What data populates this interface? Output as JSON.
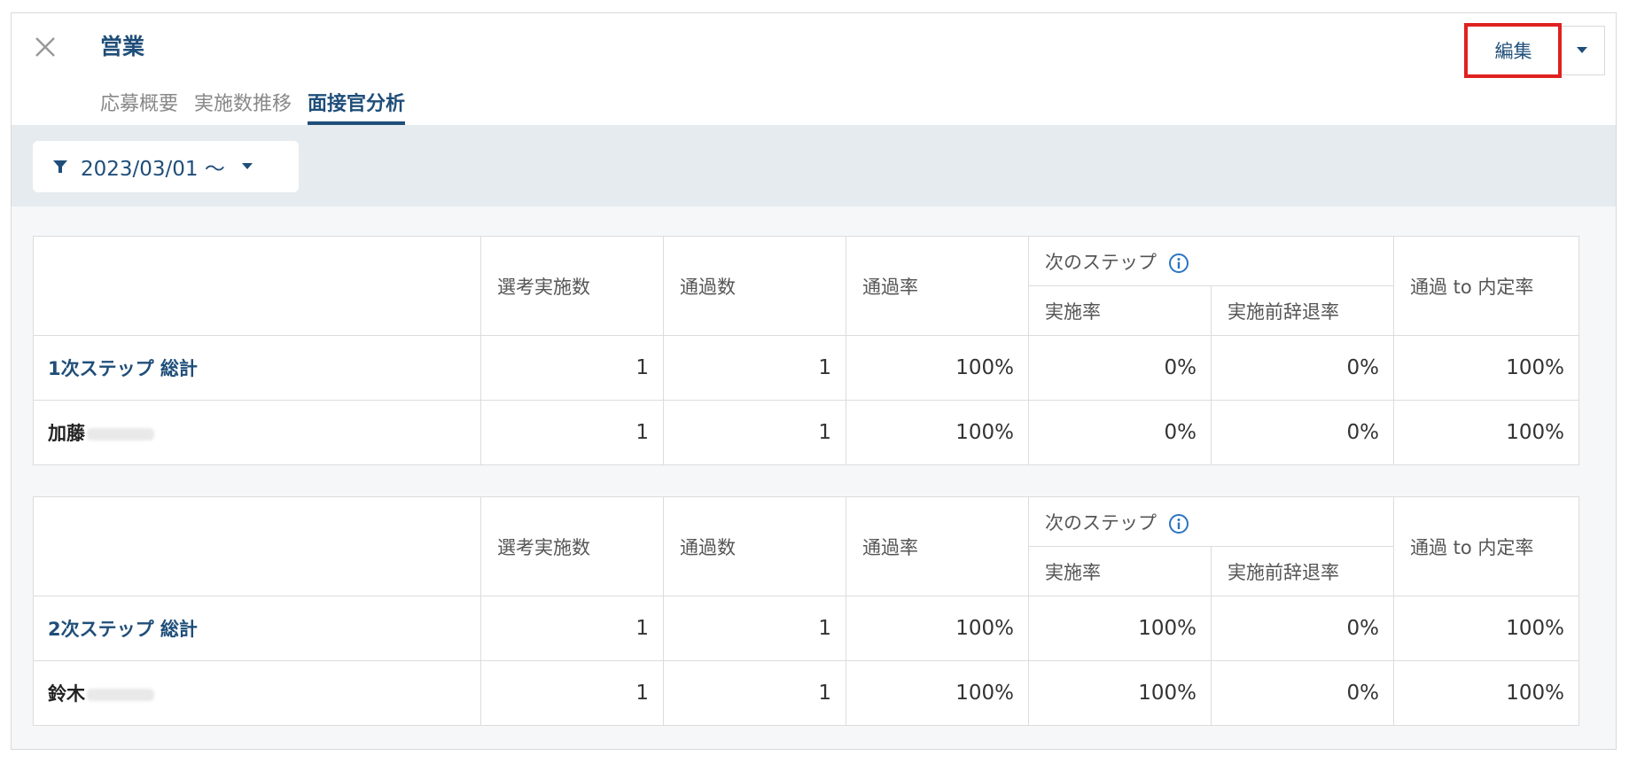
{
  "header": {
    "title": "営業",
    "tabs": [
      {
        "label": "応募概要",
        "active": false
      },
      {
        "label": "実施数推移",
        "active": false
      },
      {
        "label": "面接官分析",
        "active": true
      }
    ],
    "edit_label": "編集"
  },
  "filter": {
    "label": "2023/03/01 〜"
  },
  "columns": {
    "executed": "選考実施数",
    "passed": "通過数",
    "pass_rate": "通過率",
    "next_step": "次のステップ",
    "exec_rate": "実施率",
    "decline_rate": "実施前辞退率",
    "offer_rate": "通過 to 内定率"
  },
  "tables": [
    {
      "rows": [
        {
          "label": "1次ステップ 総計",
          "executed": "1",
          "passed": "1",
          "pass_rate": "100%",
          "exec_rate": "0%",
          "decline_rate": "0%",
          "offer_rate": "100%"
        },
        {
          "label": "加藤",
          "executed": "1",
          "passed": "1",
          "pass_rate": "100%",
          "exec_rate": "0%",
          "decline_rate": "0%",
          "offer_rate": "100%"
        }
      ]
    },
    {
      "rows": [
        {
          "label": "2次ステップ 総計",
          "executed": "1",
          "passed": "1",
          "pass_rate": "100%",
          "exec_rate": "100%",
          "decline_rate": "0%",
          "offer_rate": "100%"
        },
        {
          "label": "鈴木",
          "executed": "1",
          "passed": "1",
          "pass_rate": "100%",
          "exec_rate": "100%",
          "decline_rate": "0%",
          "offer_rate": "100%"
        }
      ]
    }
  ],
  "colors": {
    "accent": "#1f4e79",
    "highlight": "#e02020",
    "filter_bg": "#e5ebef"
  }
}
